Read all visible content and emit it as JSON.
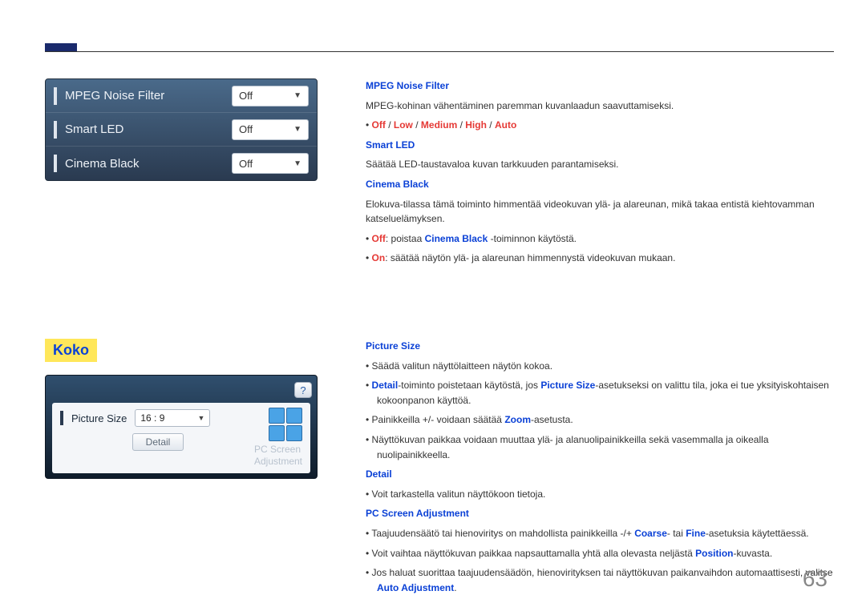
{
  "page_number": "63",
  "ui1": {
    "rows": [
      {
        "label": "MPEG Noise Filter",
        "value": "Off"
      },
      {
        "label": "Smart LED",
        "value": "Off"
      },
      {
        "label": "Cinema Black",
        "value": "Off"
      }
    ]
  },
  "section_heading": "Koko",
  "ui2": {
    "help": "?",
    "label": "Picture Size",
    "value": "16 : 9",
    "detail": "Detail",
    "ghost1": "PC Screen",
    "ghost2": "Adjustment"
  },
  "txt": {
    "mpeg_h": "MPEG Noise Filter",
    "mpeg_p": "MPEG-kohinan vähentäminen paremman kuvanlaadun saavuttamiseksi.",
    "mpeg_opts_parts": {
      "p1": "Off",
      "sep": " / ",
      "p2": "Low",
      "p3": "Medium",
      "p4": "High",
      "p5": "Auto"
    },
    "smart_h": "Smart LED",
    "smart_p": "Säätää LED-taustavaloa kuvan tarkkuuden parantamiseksi.",
    "cinema_h": "Cinema Black",
    "cinema_p": "Elokuva-tilassa tämä toiminto himmentää videokuvan ylä- ja alareunan, mikä takaa entistä kiehtovamman katseluelämyksen.",
    "cinema_off_k": "Off",
    "cinema_off_t1": ": poistaa ",
    "cinema_off_b": "Cinema Black",
    "cinema_off_t2": " -toiminnon käytöstä.",
    "cinema_on_k": "On",
    "cinema_on_t": ": säätää näytön ylä- ja alareunan himmennystä videokuvan mukaan.",
    "ps_h": "Picture Size",
    "ps_b1": "Säädä valitun näyttölaitteen näytön kokoa.",
    "ps_b2_a": "Detail",
    "ps_b2_t1": "-toiminto poistetaan käytöstä, jos ",
    "ps_b2_b": "Picture Size",
    "ps_b2_t2": "-asetukseksi on valittu tila, joka ei tue yksityiskohtaisen kokoonpanon käyttöä.",
    "ps_b3_t1": "Painikkeilla +/- voidaan säätää ",
    "ps_b3_b": "Zoom",
    "ps_b3_t2": "-asetusta.",
    "ps_b4": "Näyttökuvan paikkaa voidaan muuttaa ylä- ja alanuolipainikkeilla sekä vasemmalla ja oikealla nuolipainikkeella.",
    "detail_h": "Detail",
    "detail_b1": "Voit tarkastella valitun näyttökoon tietoja.",
    "pcsa_h": "PC Screen Adjustment",
    "pcsa_b1_t1": "Taajuudensäätö tai hienoviritys on mahdollista painikkeilla -/+ ",
    "pcsa_b1_a": "Coarse",
    "pcsa_b1_t2": "- tai ",
    "pcsa_b1_b": "Fine",
    "pcsa_b1_t3": "-asetuksia käytettäessä.",
    "pcsa_b2_t1": "Voit vaihtaa näyttökuvan paikkaa napsauttamalla yhtä alla olevasta neljästä ",
    "pcsa_b2_a": "Position",
    "pcsa_b2_t2": "-kuvasta.",
    "pcsa_b3_t1": "Jos haluat suorittaa taajuudensäädön, hienovirityksen tai näyttökuvan paikanvaihdon automaattisesti, valitse ",
    "pcsa_b3_a": "Auto Adjustment",
    "pcsa_b3_t2": "."
  }
}
